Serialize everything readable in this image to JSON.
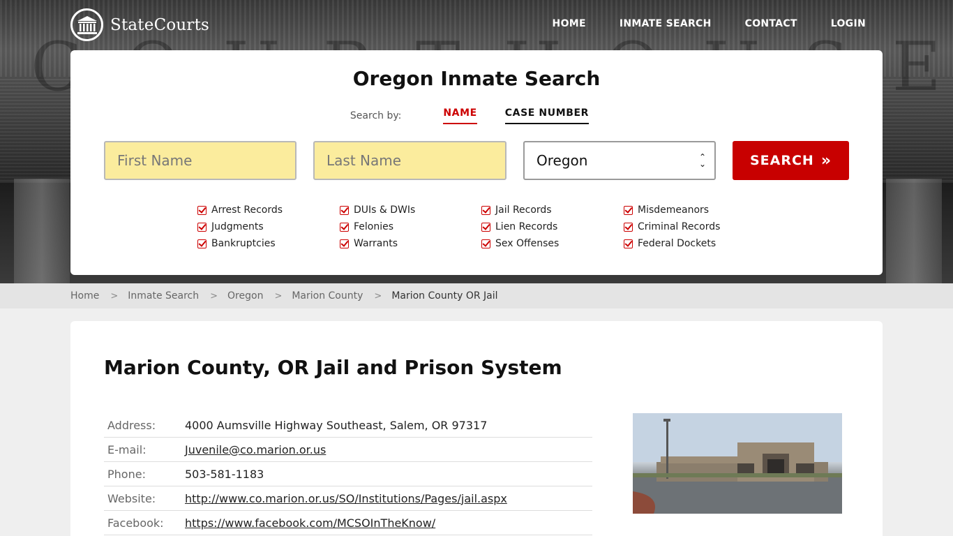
{
  "brand": {
    "name": "StateCourts",
    "icon": "courthouse-icon"
  },
  "nav": {
    "items": [
      "HOME",
      "INMATE SEARCH",
      "CONTACT",
      "LOGIN"
    ]
  },
  "search": {
    "title": "Oregon Inmate Search",
    "search_by_label": "Search by:",
    "tabs": [
      {
        "label": "NAME",
        "active": true
      },
      {
        "label": "CASE NUMBER",
        "active": false
      }
    ],
    "first_name_placeholder": "First Name",
    "last_name_placeholder": "Last Name",
    "state_selected": "Oregon",
    "button_label": "SEARCH",
    "categories": [
      "Arrest Records",
      "DUIs & DWIs",
      "Jail Records",
      "Misdemeanors",
      "Judgments",
      "Felonies",
      "Lien Records",
      "Criminal Records",
      "Bankruptcies",
      "Warrants",
      "Sex Offenses",
      "Federal Dockets"
    ]
  },
  "breadcrumb": [
    "Home",
    "Inmate Search",
    "Oregon",
    "Marion County",
    "Marion County OR Jail"
  ],
  "facility": {
    "title": "Marion County, OR Jail and Prison System",
    "details": [
      {
        "key": "Address:",
        "value": "4000 Aumsville Highway Southeast, Salem, OR 97317",
        "link": false
      },
      {
        "key": "E-mail:",
        "value": "Juvenile@co.marion.or.us",
        "link": true
      },
      {
        "key": "Phone:",
        "value": "503-581-1183",
        "link": false
      },
      {
        "key": "Website:",
        "value": "http://www.co.marion.or.us/SO/Institutions/Pages/jail.aspx",
        "link": true
      },
      {
        "key": "Facebook:",
        "value": "https://www.facebook.com/MCSOInTheKnow/",
        "link": true
      }
    ]
  },
  "colors": {
    "accent": "#c80000",
    "input_bg": "#fbec9d",
    "page_bg": "#efefef"
  }
}
